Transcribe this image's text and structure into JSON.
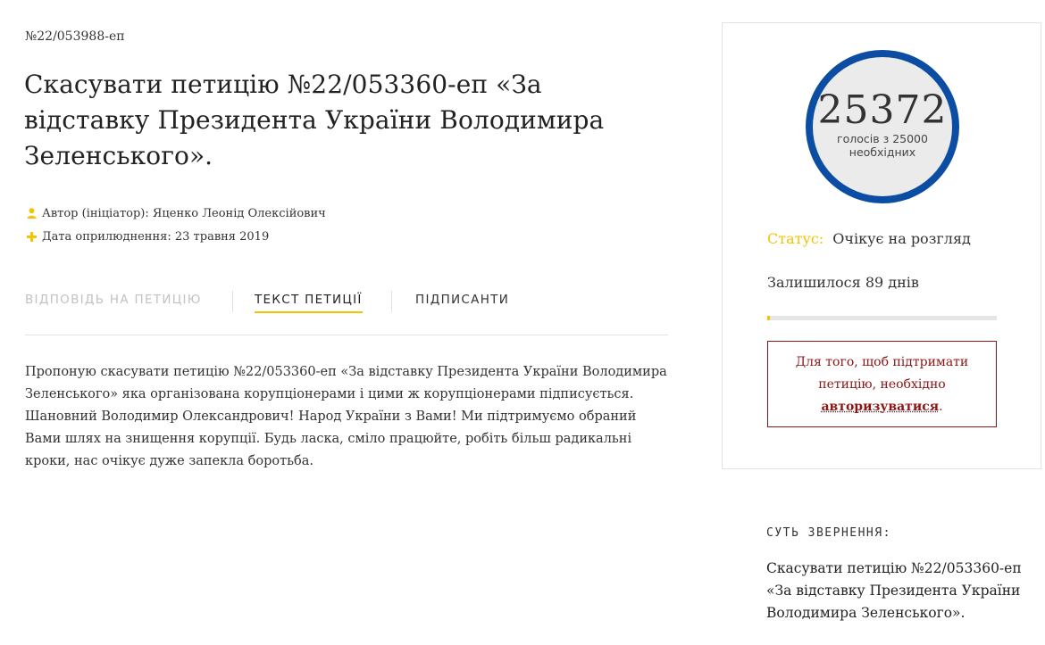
{
  "petition": {
    "number": "№22/053988-еп",
    "title": "Скасувати петицію №22/053360-еп «За відставку Президента України Володимира Зеленського».",
    "author_label": "Автор (ініціатор):",
    "author_name": "Яценко Леонід Олексійович",
    "date_label": "Дата оприлюднення:",
    "date_value": "23 травня 2019",
    "body": "Пропоную скасувати петицію №22/053360-еп «За відставку Президента України Володимира Зеленського» яка організована корупціонерами і цими ж корупціонерами підписується. Шановний Володимир Олександрович! Народ України з Вами! Ми підтримуємо обраний Вами шлях на знищення корупції. Будь ласка, сміло працюйте, робіть більш радикальні кроки, нас очікує дуже запекла боротьба."
  },
  "tabs": [
    {
      "label": "Відповідь на петицію",
      "state": "disabled"
    },
    {
      "label": "Текст петиції",
      "state": "active"
    },
    {
      "label": "Підписанти",
      "state": "normal"
    }
  ],
  "sidebar": {
    "votes_count": "25372",
    "votes_caption": "голосів з 25000 необхідних",
    "status_label": "Статус:",
    "status_value": "Очікує на розгляд",
    "days_left": "Залишилося 89 днів",
    "progress_fraction": 0.01,
    "auth_text_before": "Для того, щоб підтримати петицію, необхідно",
    "auth_link": "авторизуватися",
    "auth_text_after": "."
  },
  "summary": {
    "heading": "Суть звернення:",
    "text": "Скасувати петицію №22/053360-еп «За відставку Президента України Володимира Зеленського»."
  },
  "colors": {
    "accent_yellow": "#f2c500",
    "counter_ring": "#0b4da2",
    "auth_red": "#8a1515"
  },
  "icons": {
    "author": "user-icon",
    "date": "plus-icon"
  }
}
